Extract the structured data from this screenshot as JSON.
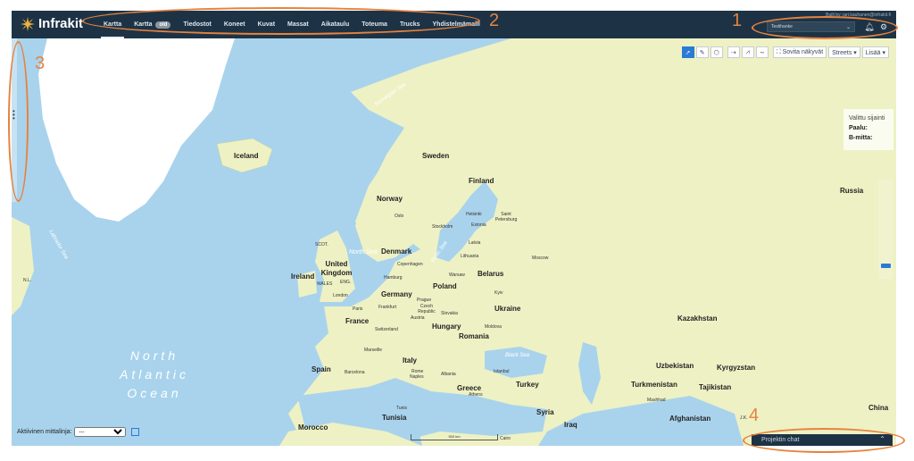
{
  "app": {
    "brand": "Infrakit",
    "user_info": "Built by: jari.kauhanen@infrakit.fi",
    "project": "Testihanke",
    "nav": [
      {
        "label": "Kartta",
        "active": true
      },
      {
        "label": "Kartta",
        "badge": "old"
      },
      {
        "label": "Tiedostot"
      },
      {
        "label": "Koneet"
      },
      {
        "label": "Kuvat"
      },
      {
        "label": "Massat"
      },
      {
        "label": "Aikataulu"
      },
      {
        "label": "Toteuma"
      },
      {
        "label": "Trucks"
      },
      {
        "label": "Yhdistelmämalli"
      }
    ]
  },
  "toolbar": {
    "fit_view": "Sovita näkyvät",
    "base_layer": "Streets ▾",
    "more": "Lisää ▾"
  },
  "location_panel": {
    "title": "Valittu sijainti",
    "pile_label": "Paalu:",
    "b_label": "B-mitta:"
  },
  "measure": {
    "label": "Aktiivinen mittalinja:",
    "value": "---"
  },
  "chat": {
    "label": "Projektin chat"
  },
  "map": {
    "scale": "500 km",
    "countries": [
      "Iceland",
      "Sweden",
      "Finland",
      "Norway",
      "Russia",
      "Denmark",
      "United Kingdom",
      "Ireland",
      "Poland",
      "Belarus",
      "Germany",
      "Ukraine",
      "France",
      "Hungary",
      "Romania",
      "Kazakhstan",
      "Spain",
      "Italy",
      "Greece",
      "Turkey",
      "Uzbekistan",
      "Kyrgyzstan",
      "Turkmenistan",
      "Tajikistan",
      "Syria",
      "Iraq",
      "Afghanistan",
      "Tunisia",
      "Morocco",
      "China",
      "Switzerland",
      "Moldova",
      "Czech Republic",
      "Slovakia",
      "Austria",
      "Lithuania",
      "Latvia",
      "Estonia",
      "Albania",
      "N.L.",
      "SCOT.",
      "WALES",
      "ENG.",
      "J.K."
    ],
    "cities": [
      "Oslo",
      "Helsinki",
      "Saint Petersburg",
      "Stockholm",
      "Moscow",
      "Copenhagen",
      "Hamburg",
      "London",
      "Paris",
      "Prague",
      "Warsaw",
      "Frankfurt",
      "Kyiv",
      "Rome",
      "Athens",
      "Istanbul",
      "Barcelona",
      "Marseille",
      "Naples",
      "Tunis",
      "Cairo",
      "Mashhad"
    ],
    "seas": [
      "Norwegian Sea",
      "North Sea",
      "Baltic Sea",
      "Black Sea",
      "North Atlantic Ocean",
      "Labrador Sea"
    ]
  },
  "annotations": [
    "1",
    "2",
    "3",
    "4"
  ],
  "colors": {
    "topbar": "#1d3345",
    "accent": "#2a7bd6",
    "sea": "#a9d3ec",
    "land": "#eef1c4",
    "annotation": "#e7823e"
  }
}
